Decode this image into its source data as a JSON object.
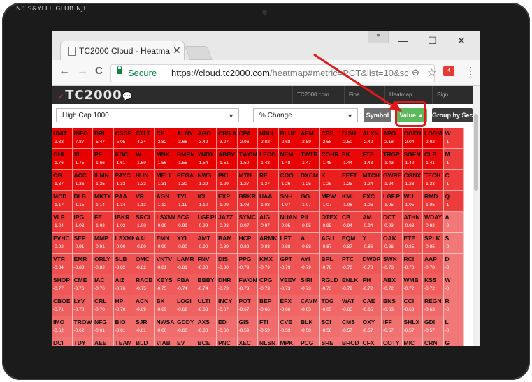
{
  "bezel_text": "NE S&YLLL GLUB NJL",
  "browser": {
    "tab_title": "TC2000 Cloud - Heatmap",
    "tab_close": "✕",
    "user_icon": "user-icon",
    "win_minimize": "—",
    "win_maximize": "☐",
    "win_close": "✕",
    "back": "←",
    "forward": "→",
    "reload": "C",
    "secure_label": "Secure",
    "url_main": "https://cloud.tc2000.com",
    "url_rest": "/heatmap#metric=PCT&list=10&sc",
    "zoom_icon": "⊖",
    "star_icon": "☆",
    "ext_badge": "4",
    "menu_icon": "⋮"
  },
  "site": {
    "logo": "TC2000",
    "nav": [
      "TC2000.com",
      "Fine",
      "Heatmap",
      "Sign"
    ],
    "list_select": "High Cap 1000",
    "metric_select": "% Change",
    "symbol_button": "Symbol",
    "value_button": "Value ▲",
    "group_button": "Group by Sec"
  },
  "colors": {
    "accent_green": "#5cb85c",
    "symbol_gray": "#6f6f6f",
    "group_dark": "#3a3a3a",
    "annotation_red": "#e2191b"
  },
  "heatmap": {
    "rows": [
      [
        [
          "UNIT",
          "-9.33"
        ],
        [
          "INFO",
          "-7.87"
        ],
        [
          "DRI",
          "-5.47"
        ],
        [
          "CSGP",
          "-5.05"
        ],
        [
          "CTLT",
          "-4.34"
        ],
        [
          "CF",
          "-3.82"
        ],
        [
          "ALNY",
          "-3.66"
        ],
        [
          "AGO",
          "-3.42"
        ],
        [
          "CBS.A",
          "-3.27"
        ],
        [
          "CPA",
          "-2.96"
        ],
        [
          "NBIX",
          "-2.82"
        ],
        [
          "BLUE",
          "-2.68"
        ],
        [
          "AEM",
          "-2.59"
        ],
        [
          "CBS",
          "-2.58"
        ],
        [
          "DISH",
          "-2.50"
        ],
        [
          "ALXN",
          "-2.42"
        ],
        [
          "APO",
          "-2.18"
        ],
        [
          "OGEN",
          "-2.04"
        ],
        [
          "LOGM",
          "-2.02"
        ],
        [
          "W",
          "-1"
        ]
      ],
      [
        [
          "OHI",
          "-1.76"
        ],
        [
          "XL",
          "-1.75"
        ],
        [
          "PE",
          "-1.66"
        ],
        [
          "KGC",
          "-1.61"
        ],
        [
          "W",
          "-1.59"
        ],
        [
          "MNK",
          "-1.56"
        ],
        [
          "BMRN",
          "-1.55"
        ],
        [
          "YNDX",
          "-1.54"
        ],
        [
          "ABBV",
          "-1.51"
        ],
        [
          "TWON",
          "-1.50"
        ],
        [
          "LECO",
          "-1.48"
        ],
        [
          "NEM",
          "-1.48"
        ],
        [
          "TWTR",
          "-1.47"
        ],
        [
          "COHR",
          "-1.45"
        ],
        [
          "PK",
          "-1.44"
        ],
        [
          "FTS",
          "-1.43"
        ],
        [
          "TRGP",
          "-1.43"
        ],
        [
          "SGEN",
          "-1.42"
        ],
        [
          "CLB",
          "-1.41"
        ],
        [
          "M",
          "-1"
        ]
      ],
      [
        [
          "CG",
          "-1.37"
        ],
        [
          "ACC",
          "-1.36"
        ],
        [
          "ILMN",
          "-1.35"
        ],
        [
          "PAYC",
          "-1.33"
        ],
        [
          "HUN",
          "-1.33"
        ],
        [
          "MELI",
          "-1.31"
        ],
        [
          "PEGA",
          "-1.30"
        ],
        [
          "NWS",
          "-1.29"
        ],
        [
          "PKI",
          "-1.29"
        ],
        [
          "MTN",
          "-1.27"
        ],
        [
          "RE",
          "-1.27"
        ],
        [
          "COO",
          "-1.26"
        ],
        [
          "DXCM",
          "-1.25"
        ],
        [
          "K",
          "-1.25"
        ],
        [
          "EEFT",
          "-1.25"
        ],
        [
          "MTCH",
          "-1.24"
        ],
        [
          "GWRE",
          "-1.24"
        ],
        [
          "CGNX",
          "-1.23"
        ],
        [
          "TECH",
          "-1.23"
        ],
        [
          "C",
          "-1"
        ]
      ],
      [
        [
          "MCD",
          "-1.17"
        ],
        [
          "DLB",
          "-1.15"
        ],
        [
          "MKTX",
          "-1.14"
        ],
        [
          "PAA",
          "-1.14"
        ],
        [
          "VR",
          "-1.13"
        ],
        [
          "AGN",
          "-1.12"
        ],
        [
          "TYL",
          "-1.11"
        ],
        [
          "ICL",
          "-1.10"
        ],
        [
          "EXP",
          "-1.09"
        ],
        [
          "BRKR",
          "-1.08"
        ],
        [
          "UAA",
          "-1.08"
        ],
        [
          "SNH",
          "-1.07"
        ],
        [
          "GG",
          "-1.07"
        ],
        [
          "MPW",
          "-1.07"
        ],
        [
          "KMI",
          "-1.06"
        ],
        [
          "EXC",
          "-1.06"
        ],
        [
          "LGF.P",
          "-1.05"
        ],
        [
          "WU",
          "-1.05"
        ],
        [
          "RMD",
          "-1.05"
        ],
        [
          "Q",
          "-1"
        ]
      ],
      [
        [
          "VLP",
          "-1.04"
        ],
        [
          "IPG",
          "-1.03"
        ],
        [
          "FE",
          "-1.03"
        ],
        [
          "IBKR",
          "-1.02"
        ],
        [
          "SRCL",
          "-1.00"
        ],
        [
          "LSXMA",
          "-0.99"
        ],
        [
          "SCG",
          "-0.99"
        ],
        [
          "LGF.PB",
          "-0.99"
        ],
        [
          "JAZZ",
          "-0.98"
        ],
        [
          "SYMC",
          "-0.97"
        ],
        [
          "AIG",
          "-0.97"
        ],
        [
          "NUAN",
          "-0.95"
        ],
        [
          "PII",
          "-0.95"
        ],
        [
          "OTEX",
          "-0.95"
        ],
        [
          "CB",
          "-0.94"
        ],
        [
          "AM",
          "-0.94"
        ],
        [
          "DCT",
          "-0.93"
        ],
        [
          "ATHN",
          "-0.93"
        ],
        [
          "WDAY",
          "-0.93"
        ],
        [
          "A",
          "-0"
        ]
      ],
      [
        [
          "EVHC",
          "-0.92"
        ],
        [
          "SEP",
          "-0.91"
        ],
        [
          "MMP",
          "-0.91"
        ],
        [
          "LSXMK",
          "-0.90"
        ],
        [
          "AAL",
          "-0.90"
        ],
        [
          "EMN",
          "-0.90"
        ],
        [
          "XYL",
          "-0.90"
        ],
        [
          "AMT",
          "-0.90"
        ],
        [
          "BAM",
          "-0.89"
        ],
        [
          "HCP",
          "-0.89"
        ],
        [
          "ARMK",
          "-0.88"
        ],
        [
          "LPT",
          "-0.88"
        ],
        [
          "A",
          "-0.88"
        ],
        [
          "AGU",
          "-0.87"
        ],
        [
          "EQM",
          "-0.87"
        ],
        [
          "Y",
          "-0.86"
        ],
        [
          "OAK",
          "-0.86"
        ],
        [
          "ETE",
          "-0.85"
        ],
        [
          "SPLK",
          "-0.85"
        ],
        [
          "S",
          "-0"
        ]
      ],
      [
        [
          "VTR",
          "-0.84"
        ],
        [
          "EMR",
          "-0.83"
        ],
        [
          "ORLY",
          "-0.82"
        ],
        [
          "SLB",
          "-0.82"
        ],
        [
          "OMC",
          "-0.82"
        ],
        [
          "VNTV",
          "-0.81"
        ],
        [
          "LAMR",
          "-0.81"
        ],
        [
          "FNV",
          "-0.80"
        ],
        [
          "DIS",
          "-0.80"
        ],
        [
          "PPG",
          "-0.79"
        ],
        [
          "KMX",
          "-0.79"
        ],
        [
          "GPT",
          "-0.79"
        ],
        [
          "AYI",
          "-0.79"
        ],
        [
          "BPL",
          "-0.78"
        ],
        [
          "PTC",
          "-0.78"
        ],
        [
          "DWDP",
          "-0.78"
        ],
        [
          "SWK",
          "-0.78"
        ],
        [
          "RCI",
          "-0.78"
        ],
        [
          "AAP",
          "-0.78"
        ],
        [
          "D",
          "-0"
        ]
      ],
      [
        [
          "SHOP",
          "-0.77"
        ],
        [
          "CME",
          "-0.76"
        ],
        [
          "IAC",
          "-0.76"
        ],
        [
          "AIZ",
          "-0.76"
        ],
        [
          "RACE",
          "-0.75"
        ],
        [
          "KEYS",
          "-0.75"
        ],
        [
          "PBA",
          "-0.74"
        ],
        [
          "BBBY",
          "-0.74"
        ],
        [
          "DHR",
          "-0.73"
        ],
        [
          "FWON",
          "-0.73"
        ],
        [
          "CPG",
          "-0.73"
        ],
        [
          "VEEV",
          "-0.73"
        ],
        [
          "SIRI",
          "-0.73"
        ],
        [
          "RGLD",
          "-0.73"
        ],
        [
          "ENLK",
          "-0.72"
        ],
        [
          "PH",
          "-0.72"
        ],
        [
          "ABX",
          "-0.72"
        ],
        [
          "WMB",
          "-0.72"
        ],
        [
          "KSS",
          "-0.72"
        ],
        [
          "W",
          "-0"
        ]
      ],
      [
        [
          "CBOE",
          "-0.71"
        ],
        [
          "LYV",
          "-0.70"
        ],
        [
          "CRL",
          "-0.70"
        ],
        [
          "HP",
          "-0.70"
        ],
        [
          "ACN",
          "-0.69"
        ],
        [
          "BX",
          "-0.69"
        ],
        [
          "LOGI",
          "-0.68"
        ],
        [
          "ULTI",
          "-0.68"
        ],
        [
          "INCY",
          "-0.67"
        ],
        [
          "POT",
          "-0.67"
        ],
        [
          "BEP",
          "-0.66"
        ],
        [
          "EFX",
          "-0.66"
        ],
        [
          "CAVM",
          "-0.65"
        ],
        [
          "TDG",
          "-0.65"
        ],
        [
          "WAT",
          "-0.65"
        ],
        [
          "CAE",
          "-0.65"
        ],
        [
          "BNS",
          "-0.63"
        ],
        [
          "CCI",
          "-0.63"
        ],
        [
          "REGN",
          "-0.63"
        ],
        [
          "R",
          "-0"
        ]
      ],
      [
        [
          "IMO",
          "-0.62"
        ],
        [
          "TROW",
          "-0.62"
        ],
        [
          "NFG",
          "-0.61"
        ],
        [
          "BIO",
          "-0.61"
        ],
        [
          "SJR",
          "-0.61"
        ],
        [
          "NWSA",
          "-0.60"
        ],
        [
          "GDDY",
          "-0.60"
        ],
        [
          "AXS",
          "-0.60"
        ],
        [
          "ED",
          "-0.60"
        ],
        [
          "GIS",
          "-0.59"
        ],
        [
          "FTI",
          "-0.59"
        ],
        [
          "CVE",
          "-0.59"
        ],
        [
          "BLK",
          "-0.58"
        ],
        [
          "SCI",
          "-0.58"
        ],
        [
          "CMS",
          "-0.57"
        ],
        [
          "OXY",
          "-0.57"
        ],
        [
          "IFF",
          "-0.57"
        ],
        [
          "SHLX",
          "-0.57"
        ],
        [
          "GDI",
          "-0.57"
        ],
        [
          "L",
          "-0"
        ]
      ],
      [
        [
          "DCI",
          "-0.56"
        ],
        [
          "TDY",
          "-0.56"
        ],
        [
          "AEE",
          "-0.56"
        ],
        [
          "TEAM",
          "-0.55"
        ],
        [
          "BLD",
          "-0.55"
        ],
        [
          "VIAB",
          "-0.55"
        ],
        [
          "EV",
          "-0.55"
        ],
        [
          "BCE",
          "-0.54"
        ],
        [
          "PNC",
          "-0.54"
        ],
        [
          "XEC",
          "-0.54"
        ],
        [
          "NLSN",
          "-0.54"
        ],
        [
          "MPK",
          "-0.53"
        ],
        [
          "PCG",
          "-0.53"
        ],
        [
          "SRE",
          "-0.53"
        ],
        [
          "BRCD",
          "-0.53"
        ],
        [
          "CFX",
          "-0.53"
        ],
        [
          "COTY",
          "-0.52"
        ],
        [
          "MIC",
          "-0.52"
        ],
        [
          "CRN",
          "-0.52"
        ],
        [
          "G",
          "-0"
        ]
      ]
    ]
  }
}
